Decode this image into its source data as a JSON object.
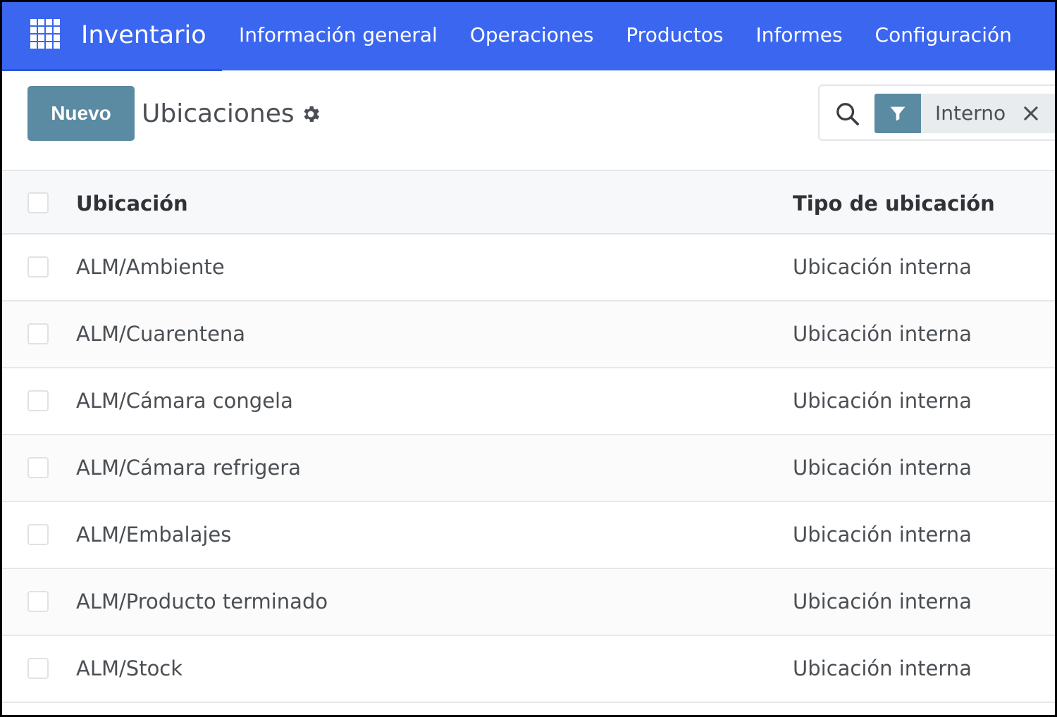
{
  "navbar": {
    "app_title": "Inventario",
    "menu": [
      {
        "label": "Información general"
      },
      {
        "label": "Operaciones"
      },
      {
        "label": "Productos"
      },
      {
        "label": "Informes"
      },
      {
        "label": "Configuración"
      }
    ]
  },
  "control_panel": {
    "new_button": "Nuevo",
    "page_title": "Ubicaciones",
    "search": {
      "facet_label": "Interno",
      "placeholder": ""
    }
  },
  "table": {
    "columns": {
      "name": "Ubicación",
      "type": "Tipo de ubicación"
    },
    "rows": [
      {
        "name": "ALM/Ambiente",
        "type": "Ubicación interna"
      },
      {
        "name": "ALM/Cuarentena",
        "type": "Ubicación interna"
      },
      {
        "name": "ALM/Cámara congela",
        "type": "Ubicación interna"
      },
      {
        "name": "ALM/Cámara refrigera",
        "type": "Ubicación interna"
      },
      {
        "name": "ALM/Embalajes",
        "type": "Ubicación interna"
      },
      {
        "name": "ALM/Producto terminado",
        "type": "Ubicación interna"
      },
      {
        "name": "ALM/Stock",
        "type": "Ubicación interna"
      }
    ]
  },
  "colors": {
    "navbar": "#3b66f0",
    "primary_button": "#5b8aa3"
  }
}
